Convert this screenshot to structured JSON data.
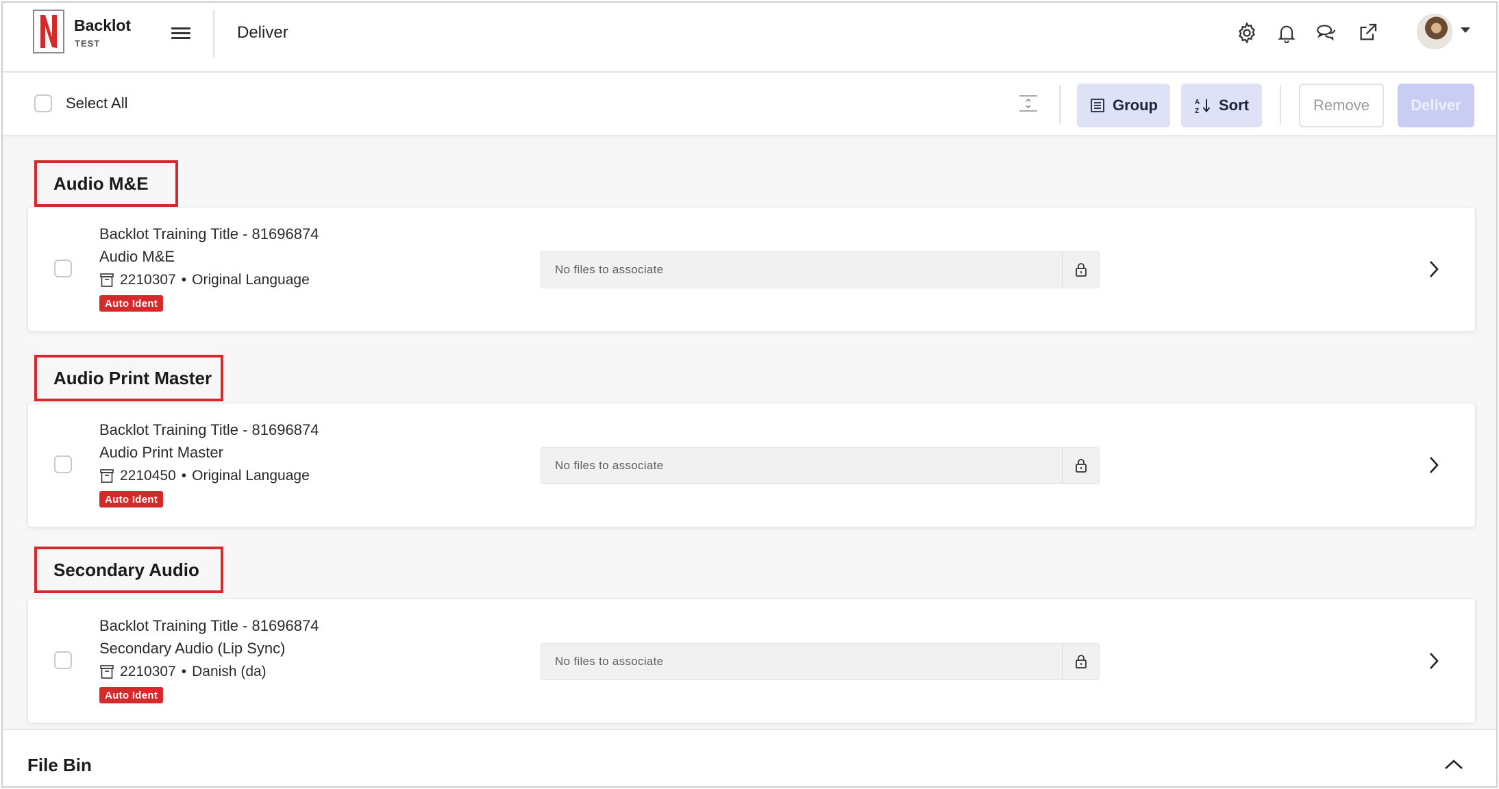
{
  "header": {
    "brand_name": "Backlot",
    "brand_env": "TEST",
    "page_title": "Deliver",
    "icons": [
      "settings-icon",
      "bell-icon",
      "chat-icon",
      "external-link-icon"
    ]
  },
  "toolbar": {
    "select_all_label": "Select All",
    "group_label": "Group",
    "sort_label": "Sort",
    "remove_label": "Remove",
    "deliver_label": "Deliver"
  },
  "sections": [
    {
      "title": "Audio M&E",
      "item": {
        "title": "Backlot Training Title - 81696874",
        "subtitle": "Audio M&E",
        "id": "2210307",
        "separator": "•",
        "language": "Original Language",
        "badge": "Auto Ident",
        "files_text": "No files to associate"
      }
    },
    {
      "title": "Audio Print Master",
      "item": {
        "title": "Backlot Training Title - 81696874",
        "subtitle": "Audio Print Master",
        "id": "2210450",
        "separator": "•",
        "language": "Original Language",
        "badge": "Auto Ident",
        "files_text": "No files to associate"
      }
    },
    {
      "title": "Secondary Audio",
      "item": {
        "title": "Backlot Training Title - 81696874",
        "subtitle": "Secondary Audio (Lip Sync)",
        "id": "2210307",
        "separator": "•",
        "language": "Danish (da)",
        "badge": "Auto Ident",
        "files_text": "No files to associate"
      }
    }
  ],
  "file_bin": {
    "title": "File Bin"
  },
  "colors": {
    "brand_red": "#d32b2b",
    "soft_button": "#dfe2f6",
    "primary_disabled": "#c9cdf3"
  }
}
